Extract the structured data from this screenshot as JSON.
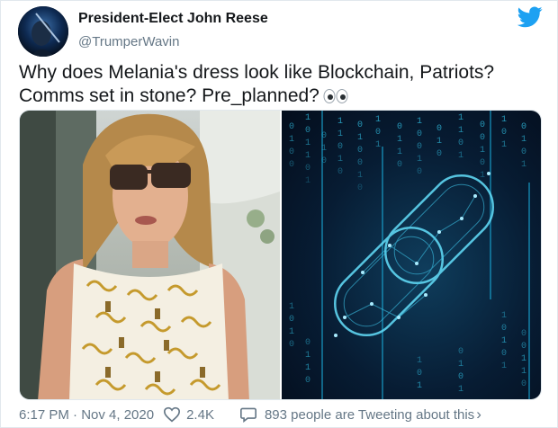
{
  "author": {
    "display_name": "President-Elect John Reese",
    "handle": "@TrumperWavin"
  },
  "tweet": {
    "line1": "Why does Melania's dress look like Blockchain, Patriots?",
    "line2": "Comms set in stone? Pre_planned?",
    "emoji_icon": "eyes-icon"
  },
  "media": {
    "images": [
      {
        "name": "photo-woman-in-patterned-dress"
      },
      {
        "name": "blockchain-chain-illustration"
      }
    ]
  },
  "footer": {
    "timestamp": "6:17 PM · Nov 4, 2020",
    "likes": "2.4K",
    "tweeting": "893 people are Tweeting about this",
    "chevron": "›"
  },
  "colors": {
    "text_primary": "#14171a",
    "text_secondary": "#657786",
    "twitter_blue": "#1da1f2",
    "binary_cyan": "#35c8e8"
  }
}
